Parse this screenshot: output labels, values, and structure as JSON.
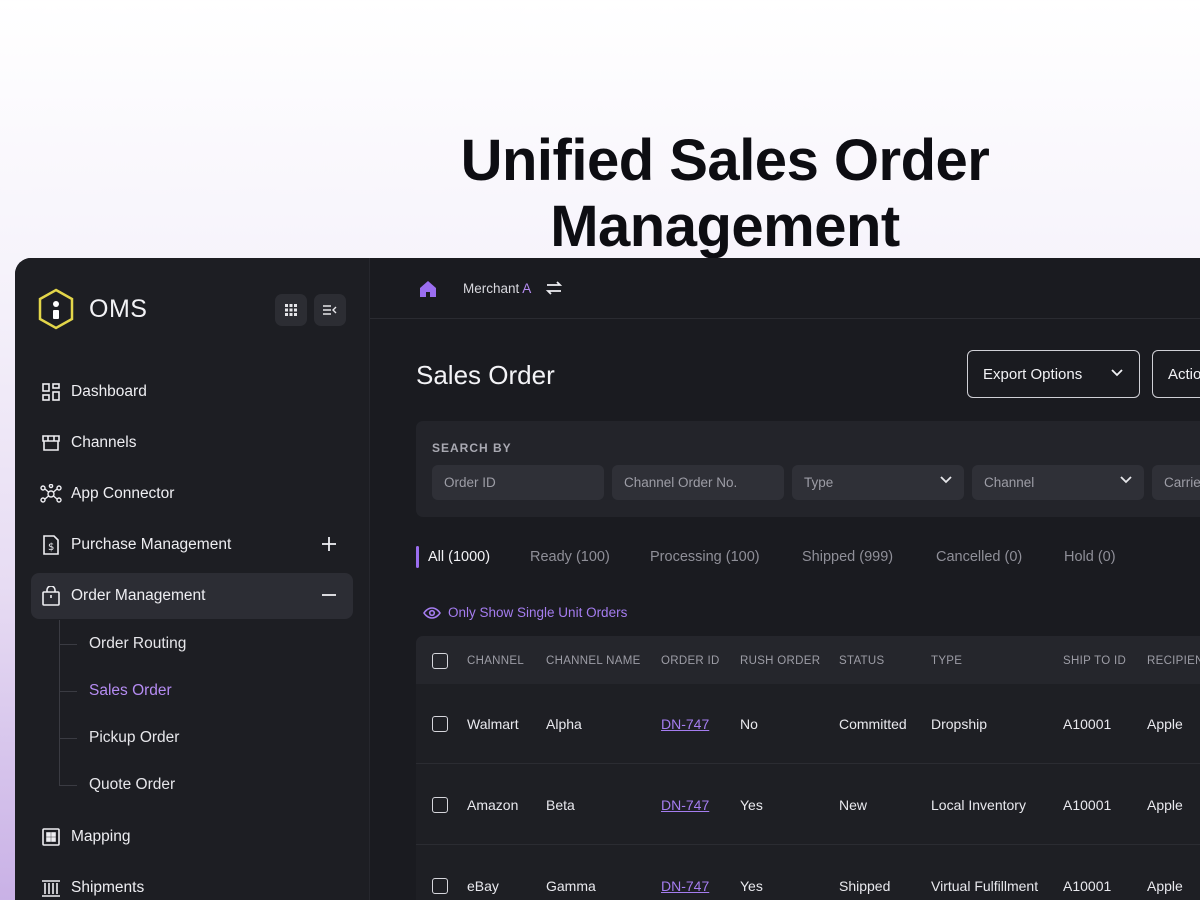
{
  "hero": {
    "title": "Unified Sales Order Management"
  },
  "sidebar": {
    "brand": "OMS",
    "items": [
      {
        "label": "Dashboard",
        "icon": "dashboard-icon"
      },
      {
        "label": "Channels",
        "icon": "storefront-icon"
      },
      {
        "label": "App Connector",
        "icon": "network-icon"
      },
      {
        "label": "Purchase Management",
        "icon": "invoice-icon",
        "expand": "+"
      },
      {
        "label": "Order Management",
        "icon": "shopping-bag-icon",
        "expand": "−",
        "active": true
      },
      {
        "label": "Mapping",
        "icon": "grid-icon"
      },
      {
        "label": "Shipments",
        "icon": "warehouse-icon"
      }
    ],
    "subitems": [
      {
        "label": "Order Routing"
      },
      {
        "label": "Sales Order",
        "active": true
      },
      {
        "label": "Pickup Order"
      },
      {
        "label": "Quote Order"
      }
    ]
  },
  "topbar": {
    "merchant_prefix": "Merchant ",
    "merchant_accent": "A"
  },
  "main": {
    "title": "Sales Order",
    "export_label": "Export Options",
    "actions_label": "Actio",
    "search": {
      "label": "SEARCH BY",
      "fields": [
        "Order ID",
        "Channel Order No.",
        "Type",
        "Channel",
        "Carrie"
      ]
    },
    "tabs": [
      "All (1000)",
      "Ready (100)",
      "Processing (100)",
      "Shipped (999)",
      "Cancelled (0)",
      "Hold (0)"
    ],
    "filter_toggle": "Only Show Single Unit Orders"
  },
  "table": {
    "headers": [
      "CHANNEL",
      "CHANNEL NAME",
      "ORDER ID",
      "RUSH ORDER",
      "STATUS",
      "TYPE",
      "SHIP TO ID",
      "RECIPIEN"
    ],
    "rows": [
      [
        "Walmart",
        "Alpha",
        "DN-747",
        "No",
        "Committed",
        "Dropship",
        "A10001",
        "Apple"
      ],
      [
        "Amazon",
        "Beta",
        "DN-747",
        "Yes",
        "New",
        "Local Inventory",
        "A10001",
        "Apple"
      ],
      [
        "eBay",
        "Gamma",
        "DN-747",
        "Yes",
        "Shipped",
        "Virtual Fulfillment",
        "A10001",
        "Apple"
      ]
    ]
  },
  "colors": {
    "accent": "#9b6ef0",
    "bg_dark": "#1a1b20",
    "logo": "#e3d64a"
  }
}
